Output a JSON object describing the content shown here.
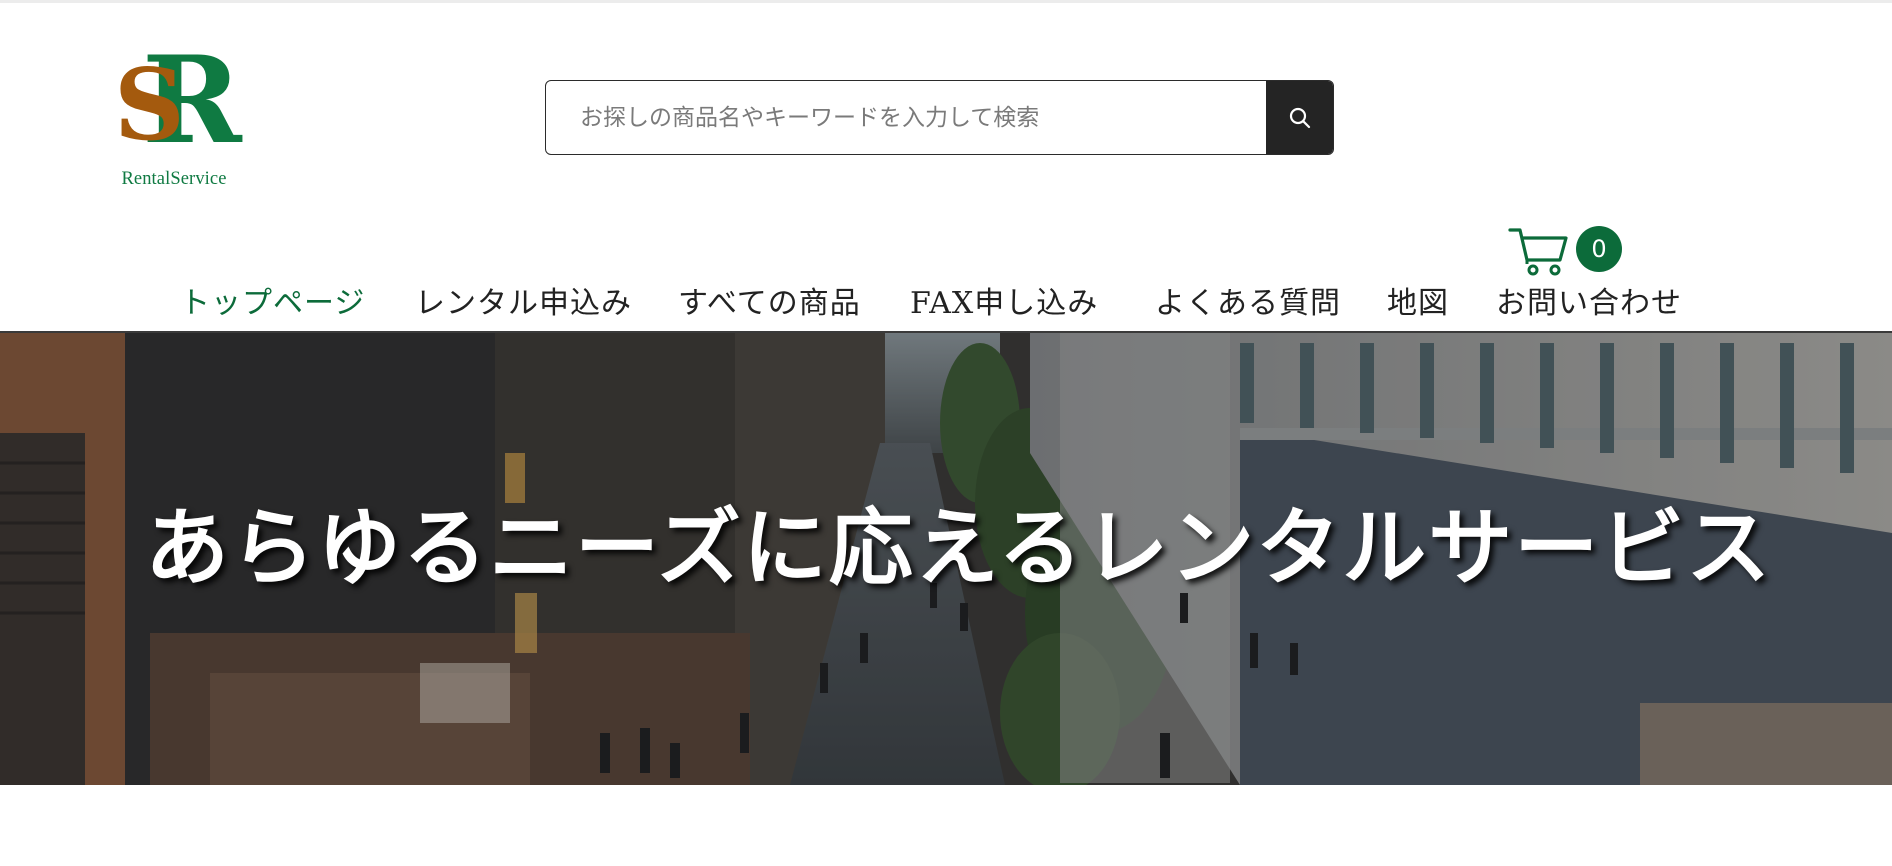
{
  "brand": {
    "monogram_s": "S",
    "monogram_r": "R",
    "tagline_part1": "Rental",
    "tagline_part2": "Service",
    "green": "#0f7a42",
    "brown": "#a45a0e"
  },
  "search": {
    "placeholder": "お探しの商品名やキーワードを入力して検索",
    "value": "",
    "button_icon": "search-icon"
  },
  "cart": {
    "icon": "cart-icon",
    "count": "0",
    "badge_color": "#0c6b3a"
  },
  "nav": {
    "items": [
      {
        "label": "トップページ",
        "active": true
      },
      {
        "label": "レンタル申込み",
        "active": false
      },
      {
        "label": "すべての商品",
        "active": false
      },
      {
        "label": "FAX申し込み",
        "active": false
      },
      {
        "label": "よくある質問",
        "active": false
      },
      {
        "label": "地図",
        "active": false
      },
      {
        "label": "お問い合わせ",
        "active": false
      }
    ],
    "active_color": "#0c6b3a"
  },
  "hero": {
    "headline": "あらゆるニーズに応えるレンタルサービス"
  }
}
